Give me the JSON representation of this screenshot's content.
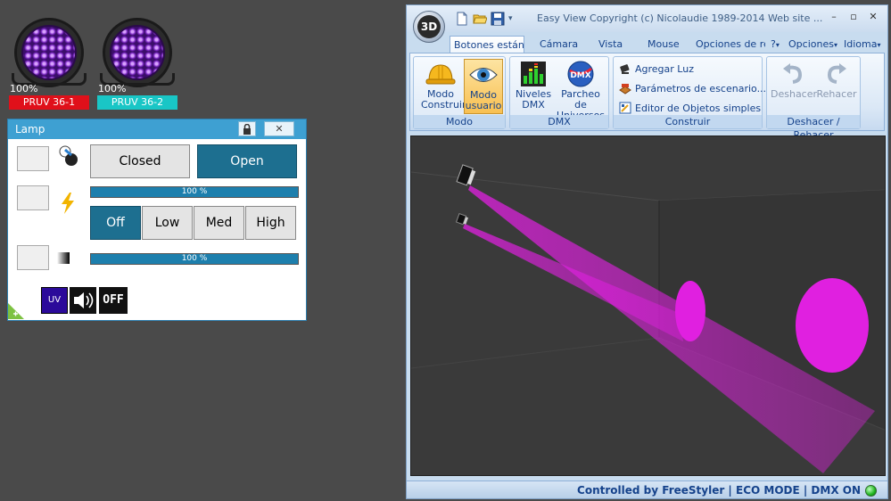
{
  "fixtures": [
    {
      "level": "100%",
      "label": "PRUV 36-1",
      "tag_color": "#e0101a"
    },
    {
      "level": "100%",
      "label": "PRUV 36-2",
      "tag_color": "#19c6c6"
    }
  ],
  "lamp_panel": {
    "title": "Lamp",
    "shutter": {
      "closed_label": "Closed",
      "open_label": "Open",
      "selected": "Open"
    },
    "dimmer_level": "100 %",
    "strobe": {
      "options": [
        "Off",
        "Low",
        "Med",
        "High"
      ],
      "selected": "Off"
    },
    "fade_level": "100 %",
    "badges": {
      "uv": "UV",
      "off": "OFF"
    }
  },
  "window": {
    "orb_label": "3D",
    "title": "Easy View   Copyright (c) Nicolaudie 1989-2014   Web site ...",
    "tabs": {
      "botones": "Botones estándar",
      "camara": "Cámara",
      "vista": "Vista",
      "mouse": "Mouse",
      "opciones_re": "Opciones de re",
      "help": "?",
      "opciones": "Opciones",
      "idioma": "Idioma"
    },
    "ribbon": {
      "modo": {
        "label": "Modo",
        "construir": "Modo\nConstruir",
        "usuario": "Modo\nusuario"
      },
      "dmx": {
        "label": "DMX",
        "niveles": "Niveles\nDMX",
        "parcheo": "Parcheo de\nUniversos"
      },
      "construir": {
        "label": "Construir",
        "agregar": "Agregar Luz",
        "parametros": "Parámetros de escenario...",
        "editor": "Editor de Objetos simples"
      },
      "deshacer": {
        "label": "Deshacer / Rehacer",
        "deshacer": "Deshacer",
        "rehacer": "Rehacer"
      }
    },
    "status": "Controlled by FreeStyler  |  ECO MODE  |  DMX ON"
  },
  "colors": {
    "beam": "#e020e0",
    "accent_dark": "#1d6f90",
    "ribbon_text": "#15428b"
  }
}
